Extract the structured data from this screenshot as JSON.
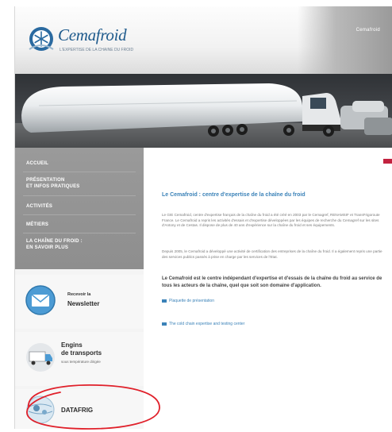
{
  "header": {
    "logo_text": "Cemafroid",
    "logo_tagline": "L'EXPERTISE DE LA CHAINE DU FROID",
    "lang_link": "Cemafroid"
  },
  "nav": {
    "items": [
      {
        "label": "ACCUEIL"
      },
      {
        "label": "PRÉSENTATION\nET INFOS PRATIQUES"
      },
      {
        "label": "ACTIVITÉS"
      },
      {
        "label": "MÉTIERS"
      },
      {
        "label": "LA CHAÎNE DU FROID :\nEN SAVOIR PLUS"
      }
    ]
  },
  "promos": {
    "newsletter": {
      "small": "Recevoir la",
      "big": "Newsletter"
    },
    "engins": {
      "big": "Engins\nde transports",
      "tiny": "sous température dirigée"
    },
    "datafrig": {
      "big": "DATAFRIG"
    }
  },
  "main": {
    "title": "Le Cemafroid : centre d'expertise de la chaîne du froid",
    "para1": "Le GIE Cemafroid, centre d'expertise français de la chaîne du froid a été créé en 2003 par le Cemagref, RENAMSIF et TransFrigoroute France. Le Cemafroid a repris les activités d'essais et d'expertise développées par les équipes de recherche du Cemagref sur les sites d'Antony et de Cestas. Il dispose de plus de 40 ans d'expérience sur la chaîne du froid et ses équipements.",
    "para2": "Depuis 2005, le Cemafroid a développé une activité de certification des entreprises de la chaîne du froid. Il a également repris une partie des services publics passés à prise en charge par les services de l'Etat.",
    "strong": "Le Cemafroid est le centre indépendant d'expertise et d'essais de la chaîne du froid au service de tous les acteurs de la chaîne, quel que soit son domaine d'application.",
    "link1": "Plaquette de présentation",
    "link2": "The cold chain expertise and testing center"
  },
  "colors": {
    "accent_blue": "#3b82b8",
    "nav_gray": "#8e8e8e",
    "annotation_red": "#e0202a"
  }
}
